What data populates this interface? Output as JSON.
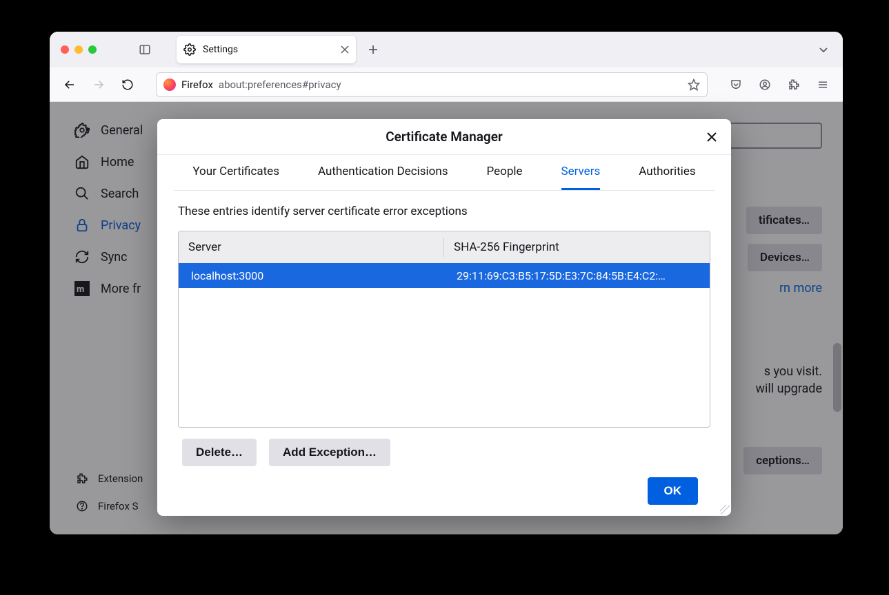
{
  "window": {
    "tab_title": "Settings",
    "url_product": "Firefox",
    "url_path": "about:preferences#privacy"
  },
  "sidebar": {
    "items": [
      {
        "label": "General"
      },
      {
        "label": "Home"
      },
      {
        "label": "Search"
      },
      {
        "label": "Privacy"
      },
      {
        "label": "Sync"
      },
      {
        "label": "More fr"
      }
    ],
    "bottom": [
      {
        "label": "Extension"
      },
      {
        "label": "Firefox S"
      }
    ]
  },
  "background": {
    "btn_certs": "tificates…",
    "btn_devices": "Devices…",
    "link_learn_more": "rn more",
    "text1": "s you visit.",
    "text2": "will upgrade",
    "btn_exceptions": "ceptions…"
  },
  "modal": {
    "title": "Certificate Manager",
    "tabs": [
      "Your Certificates",
      "Authentication Decisions",
      "People",
      "Servers",
      "Authorities"
    ],
    "active_tab_index": 3,
    "description": "These entries identify server certificate error exceptions",
    "columns": {
      "server": "Server",
      "fingerprint": "SHA-256 Fingerprint"
    },
    "rows": [
      {
        "server": "localhost:3000",
        "fingerprint": "29:11:69:C3:B5:17:5D:E3:7C:84:5B:E4:C2:…"
      }
    ],
    "selected_row_index": 0,
    "btn_delete": "Delete…",
    "btn_add": "Add Exception…",
    "btn_ok": "OK"
  }
}
